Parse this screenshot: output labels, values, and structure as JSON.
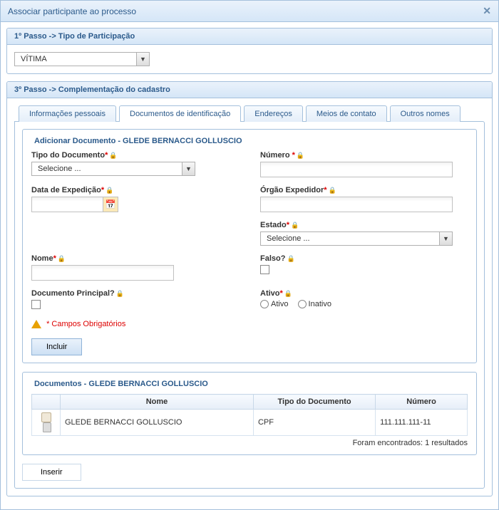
{
  "title": "Associar participante ao processo",
  "step1": {
    "header": "1º Passo -> Tipo de Participação",
    "selected": "VÍTIMA"
  },
  "step3": {
    "header": "3º Passo -> Complementação do cadastro"
  },
  "tabs": {
    "pessoais": "Informações pessoais",
    "documentos": "Documentos de identificação",
    "enderecos": "Endereços",
    "meios": "Meios de contato",
    "outros": "Outros nomes"
  },
  "form": {
    "fieldset_title": "Adicionar Documento - GLEDE BERNACCI GOLLUSCIO",
    "tipo_label": "Tipo do Documento",
    "tipo_placeholder": "Selecione ...",
    "numero_label": "Número",
    "data_label": "Data de Expedição",
    "orgao_label": "Órgão Expedidor",
    "estado_label": "Estado",
    "estado_placeholder": "Selecione ...",
    "nome_label": "Nome",
    "falso_label": "Falso?",
    "principal_label": "Documento Principal?",
    "ativo_label": "Ativo",
    "ativo_opt": "Ativo",
    "inativo_opt": "Inativo",
    "campos_obrig": "* Campos Obrigatórios",
    "incluir": "Incluir"
  },
  "docs": {
    "fieldset_title": "Documentos - GLEDE BERNACCI GOLLUSCIO",
    "col_nome": "Nome",
    "col_tipo": "Tipo do Documento",
    "col_numero": "Número",
    "rows": [
      {
        "nome": "GLEDE BERNACCI GOLLUSCIO",
        "tipo": "CPF",
        "numero": "111.111.111-11"
      }
    ],
    "result_text": "Foram encontrados: 1 resultados"
  },
  "inserir": "Inserir"
}
